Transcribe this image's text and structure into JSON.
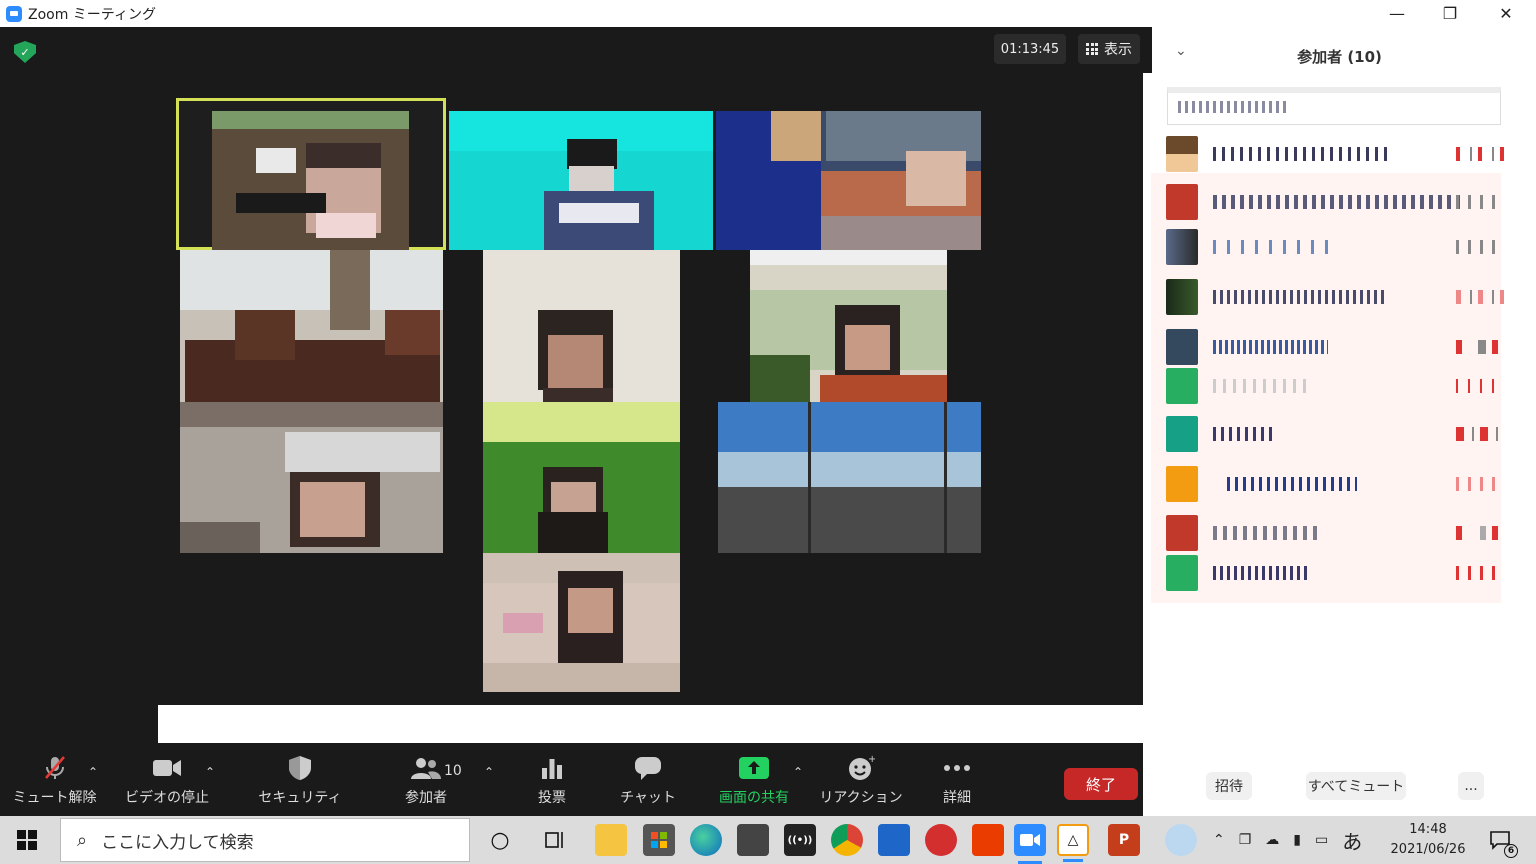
{
  "window": {
    "title": "Zoom ミーティング",
    "minimize_icon": "minimize-icon",
    "restore_icon": "restore-icon",
    "close_icon": "close-icon"
  },
  "meeting": {
    "timer": "01:13:45",
    "view_label": "表示",
    "security_shield_icon": "shield-check-icon"
  },
  "toolbar": {
    "mute": {
      "label": "ミュート解除",
      "icon": "mic-off-icon"
    },
    "video": {
      "label": "ビデオの停止",
      "icon": "video-camera-icon"
    },
    "security": {
      "label": "セキュリティ",
      "icon": "shield-icon"
    },
    "participants": {
      "label": "参加者",
      "count": "10",
      "icon": "participants-icon"
    },
    "polls": {
      "label": "投票",
      "icon": "bar-chart-icon"
    },
    "chat": {
      "label": "チャット",
      "icon": "chat-bubble-icon"
    },
    "share": {
      "label": "画面の共有",
      "icon": "share-screen-icon"
    },
    "reactions": {
      "label": "リアクション",
      "icon": "emoji-add-icon"
    },
    "more": {
      "label": "詳細",
      "icon": "ellipsis-icon"
    },
    "end": {
      "label": "終了"
    }
  },
  "panel": {
    "title": "参加者 (10)",
    "collapse_icon": "chevron-down-icon",
    "buttons": {
      "invite": "招待",
      "mute_all": "すべてミュート",
      "more": "..."
    }
  },
  "taskbar": {
    "search_placeholder": "ここに入力して検索",
    "time": "14:48",
    "date": "2021/06/26",
    "ime": "あ",
    "notification_count": "6"
  },
  "colors": {
    "share_green": "#23d160",
    "end_red": "#c62828",
    "active_speaker": "#d4e157",
    "zoom_blue": "#2d8cff"
  }
}
